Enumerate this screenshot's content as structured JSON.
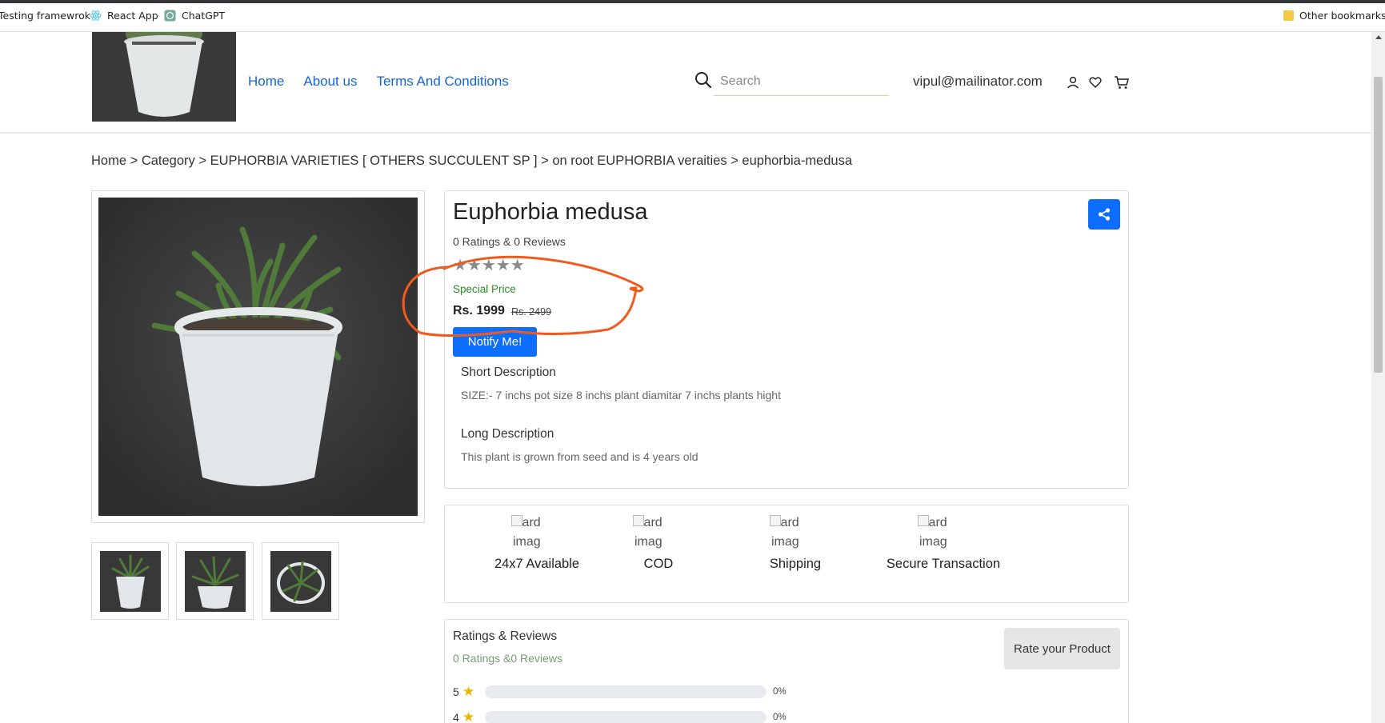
{
  "browser": {
    "bookmarks": [
      {
        "label": "Testing framewrok"
      },
      {
        "label": "React App"
      },
      {
        "label": "ChatGPT"
      }
    ],
    "other_bookmarks": "Other bookmarks"
  },
  "header": {
    "nav": [
      "Home",
      "About us",
      "Terms And Conditions"
    ],
    "search_placeholder": "Search",
    "user_email": "vipul@mailinator.com"
  },
  "breadcrumb": [
    "Home",
    "Category",
    "EUPHORBIA VARIETIES [ OTHERS SUCCULENT SP ]",
    "on root EUPHORBIA veraities",
    "euphorbia-medusa"
  ],
  "breadcrumb_separator": " > ",
  "product": {
    "title": "Euphorbia medusa",
    "rating_summary": "0 Ratings & 0 Reviews",
    "stars": "★★★★★",
    "rating_value": 0,
    "special_label": "Special Price",
    "price": "Rs. 1999",
    "old_price": "Rs. 2499",
    "notify_label": "Notify Me!",
    "short_desc_heading": "Short Description",
    "short_desc": "SIZE:- 7 inchs pot size 8 inchs plant diamitar 7 inchs plants hight",
    "long_desc_heading": "Long Description",
    "long_desc": "This plant is grown from seed and is 4 years old"
  },
  "features": [
    {
      "alt": "Card imag",
      "label": "24x7 Available"
    },
    {
      "alt": "Card imag",
      "label": "COD"
    },
    {
      "alt": "Card imag",
      "label": "Shipping"
    },
    {
      "alt": "Card imag",
      "label": "Secure Transaction"
    }
  ],
  "ratings": {
    "heading": "Ratings & Reviews",
    "summary": "0 Ratings &0 Reviews",
    "rate_button": "Rate your Product",
    "rows": [
      {
        "stars": "5",
        "percent": "0%",
        "fraction": 0
      },
      {
        "stars": "4",
        "percent": "0%",
        "fraction": 0
      }
    ]
  },
  "colors": {
    "link": "#1565d8",
    "primary": "#0d6efd",
    "special": "#2e8b2e",
    "annotation": "#f05a1e",
    "star_filled": "#f2b200"
  }
}
